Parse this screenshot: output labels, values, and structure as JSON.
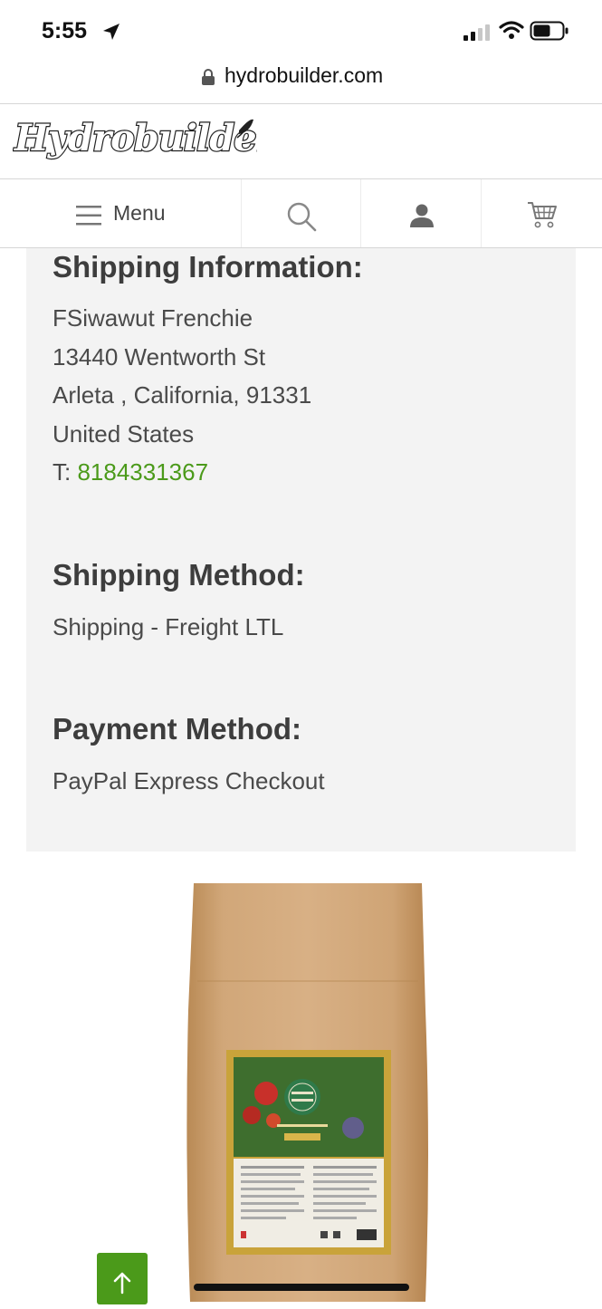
{
  "status_bar": {
    "time": "5:55"
  },
  "browser": {
    "url": "hydrobuilder.com"
  },
  "header": {
    "logo_text": "Hydrobuilder"
  },
  "nav": {
    "menu_label": "Menu"
  },
  "shipping_info": {
    "heading": "Shipping Information:",
    "name": "FSiwawut Frenchie",
    "street": "13440 Wentworth St",
    "city_line": "Arleta , California, 91331",
    "country": "United States",
    "phone_prefix": "T: ",
    "phone": "8184331367"
  },
  "shipping_method": {
    "heading": "Shipping Method:",
    "value": "Shipping - Freight LTL"
  },
  "payment_method": {
    "heading": "Payment Method:",
    "value": "PayPal Express Checkout"
  },
  "product": {
    "image_name": "product-bag-image"
  },
  "colors": {
    "accent": "#4b9a1a",
    "panel_bg": "#f3f3f3"
  }
}
